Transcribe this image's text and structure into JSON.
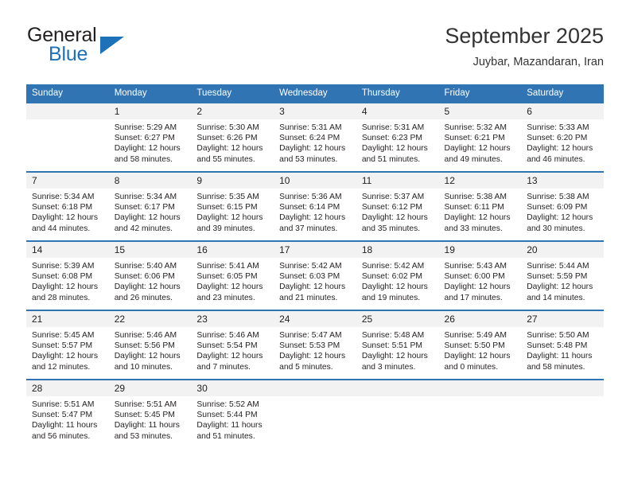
{
  "brand": {
    "name_top": "General",
    "name_bottom": "Blue"
  },
  "header": {
    "title": "September 2025",
    "subtitle": "Juybar, Mazandaran, Iran"
  },
  "weekday_headers": [
    "Sunday",
    "Monday",
    "Tuesday",
    "Wednesday",
    "Thursday",
    "Friday",
    "Saturday"
  ],
  "colors": {
    "header_blue": "#3174b4",
    "daynum_band": "#f2f2f2",
    "logo_blue": "#1d71b8",
    "text": "#231f20"
  },
  "labels": {
    "sunrise_prefix": "Sunrise:",
    "sunset_prefix": "Sunset:",
    "daylight_prefix": "Daylight:"
  },
  "weeks": [
    [
      {
        "day": "",
        "sunrise": "",
        "sunset": "",
        "daylight_line1": "",
        "daylight_line2": ""
      },
      {
        "day": "1",
        "sunrise": "Sunrise: 5:29 AM",
        "sunset": "Sunset: 6:27 PM",
        "daylight_line1": "Daylight: 12 hours",
        "daylight_line2": "and 58 minutes."
      },
      {
        "day": "2",
        "sunrise": "Sunrise: 5:30 AM",
        "sunset": "Sunset: 6:26 PM",
        "daylight_line1": "Daylight: 12 hours",
        "daylight_line2": "and 55 minutes."
      },
      {
        "day": "3",
        "sunrise": "Sunrise: 5:31 AM",
        "sunset": "Sunset: 6:24 PM",
        "daylight_line1": "Daylight: 12 hours",
        "daylight_line2": "and 53 minutes."
      },
      {
        "day": "4",
        "sunrise": "Sunrise: 5:31 AM",
        "sunset": "Sunset: 6:23 PM",
        "daylight_line1": "Daylight: 12 hours",
        "daylight_line2": "and 51 minutes."
      },
      {
        "day": "5",
        "sunrise": "Sunrise: 5:32 AM",
        "sunset": "Sunset: 6:21 PM",
        "daylight_line1": "Daylight: 12 hours",
        "daylight_line2": "and 49 minutes."
      },
      {
        "day": "6",
        "sunrise": "Sunrise: 5:33 AM",
        "sunset": "Sunset: 6:20 PM",
        "daylight_line1": "Daylight: 12 hours",
        "daylight_line2": "and 46 minutes."
      }
    ],
    [
      {
        "day": "7",
        "sunrise": "Sunrise: 5:34 AM",
        "sunset": "Sunset: 6:18 PM",
        "daylight_line1": "Daylight: 12 hours",
        "daylight_line2": "and 44 minutes."
      },
      {
        "day": "8",
        "sunrise": "Sunrise: 5:34 AM",
        "sunset": "Sunset: 6:17 PM",
        "daylight_line1": "Daylight: 12 hours",
        "daylight_line2": "and 42 minutes."
      },
      {
        "day": "9",
        "sunrise": "Sunrise: 5:35 AM",
        "sunset": "Sunset: 6:15 PM",
        "daylight_line1": "Daylight: 12 hours",
        "daylight_line2": "and 39 minutes."
      },
      {
        "day": "10",
        "sunrise": "Sunrise: 5:36 AM",
        "sunset": "Sunset: 6:14 PM",
        "daylight_line1": "Daylight: 12 hours",
        "daylight_line2": "and 37 minutes."
      },
      {
        "day": "11",
        "sunrise": "Sunrise: 5:37 AM",
        "sunset": "Sunset: 6:12 PM",
        "daylight_line1": "Daylight: 12 hours",
        "daylight_line2": "and 35 minutes."
      },
      {
        "day": "12",
        "sunrise": "Sunrise: 5:38 AM",
        "sunset": "Sunset: 6:11 PM",
        "daylight_line1": "Daylight: 12 hours",
        "daylight_line2": "and 33 minutes."
      },
      {
        "day": "13",
        "sunrise": "Sunrise: 5:38 AM",
        "sunset": "Sunset: 6:09 PM",
        "daylight_line1": "Daylight: 12 hours",
        "daylight_line2": "and 30 minutes."
      }
    ],
    [
      {
        "day": "14",
        "sunrise": "Sunrise: 5:39 AM",
        "sunset": "Sunset: 6:08 PM",
        "daylight_line1": "Daylight: 12 hours",
        "daylight_line2": "and 28 minutes."
      },
      {
        "day": "15",
        "sunrise": "Sunrise: 5:40 AM",
        "sunset": "Sunset: 6:06 PM",
        "daylight_line1": "Daylight: 12 hours",
        "daylight_line2": "and 26 minutes."
      },
      {
        "day": "16",
        "sunrise": "Sunrise: 5:41 AM",
        "sunset": "Sunset: 6:05 PM",
        "daylight_line1": "Daylight: 12 hours",
        "daylight_line2": "and 23 minutes."
      },
      {
        "day": "17",
        "sunrise": "Sunrise: 5:42 AM",
        "sunset": "Sunset: 6:03 PM",
        "daylight_line1": "Daylight: 12 hours",
        "daylight_line2": "and 21 minutes."
      },
      {
        "day": "18",
        "sunrise": "Sunrise: 5:42 AM",
        "sunset": "Sunset: 6:02 PM",
        "daylight_line1": "Daylight: 12 hours",
        "daylight_line2": "and 19 minutes."
      },
      {
        "day": "19",
        "sunrise": "Sunrise: 5:43 AM",
        "sunset": "Sunset: 6:00 PM",
        "daylight_line1": "Daylight: 12 hours",
        "daylight_line2": "and 17 minutes."
      },
      {
        "day": "20",
        "sunrise": "Sunrise: 5:44 AM",
        "sunset": "Sunset: 5:59 PM",
        "daylight_line1": "Daylight: 12 hours",
        "daylight_line2": "and 14 minutes."
      }
    ],
    [
      {
        "day": "21",
        "sunrise": "Sunrise: 5:45 AM",
        "sunset": "Sunset: 5:57 PM",
        "daylight_line1": "Daylight: 12 hours",
        "daylight_line2": "and 12 minutes."
      },
      {
        "day": "22",
        "sunrise": "Sunrise: 5:46 AM",
        "sunset": "Sunset: 5:56 PM",
        "daylight_line1": "Daylight: 12 hours",
        "daylight_line2": "and 10 minutes."
      },
      {
        "day": "23",
        "sunrise": "Sunrise: 5:46 AM",
        "sunset": "Sunset: 5:54 PM",
        "daylight_line1": "Daylight: 12 hours",
        "daylight_line2": "and 7 minutes."
      },
      {
        "day": "24",
        "sunrise": "Sunrise: 5:47 AM",
        "sunset": "Sunset: 5:53 PM",
        "daylight_line1": "Daylight: 12 hours",
        "daylight_line2": "and 5 minutes."
      },
      {
        "day": "25",
        "sunrise": "Sunrise: 5:48 AM",
        "sunset": "Sunset: 5:51 PM",
        "daylight_line1": "Daylight: 12 hours",
        "daylight_line2": "and 3 minutes."
      },
      {
        "day": "26",
        "sunrise": "Sunrise: 5:49 AM",
        "sunset": "Sunset: 5:50 PM",
        "daylight_line1": "Daylight: 12 hours",
        "daylight_line2": "and 0 minutes."
      },
      {
        "day": "27",
        "sunrise": "Sunrise: 5:50 AM",
        "sunset": "Sunset: 5:48 PM",
        "daylight_line1": "Daylight: 11 hours",
        "daylight_line2": "and 58 minutes."
      }
    ],
    [
      {
        "day": "28",
        "sunrise": "Sunrise: 5:51 AM",
        "sunset": "Sunset: 5:47 PM",
        "daylight_line1": "Daylight: 11 hours",
        "daylight_line2": "and 56 minutes."
      },
      {
        "day": "29",
        "sunrise": "Sunrise: 5:51 AM",
        "sunset": "Sunset: 5:45 PM",
        "daylight_line1": "Daylight: 11 hours",
        "daylight_line2": "and 53 minutes."
      },
      {
        "day": "30",
        "sunrise": "Sunrise: 5:52 AM",
        "sunset": "Sunset: 5:44 PM",
        "daylight_line1": "Daylight: 11 hours",
        "daylight_line2": "and 51 minutes."
      },
      {
        "day": "",
        "sunrise": "",
        "sunset": "",
        "daylight_line1": "",
        "daylight_line2": ""
      },
      {
        "day": "",
        "sunrise": "",
        "sunset": "",
        "daylight_line1": "",
        "daylight_line2": ""
      },
      {
        "day": "",
        "sunrise": "",
        "sunset": "",
        "daylight_line1": "",
        "daylight_line2": ""
      },
      {
        "day": "",
        "sunrise": "",
        "sunset": "",
        "daylight_line1": "",
        "daylight_line2": ""
      }
    ]
  ]
}
